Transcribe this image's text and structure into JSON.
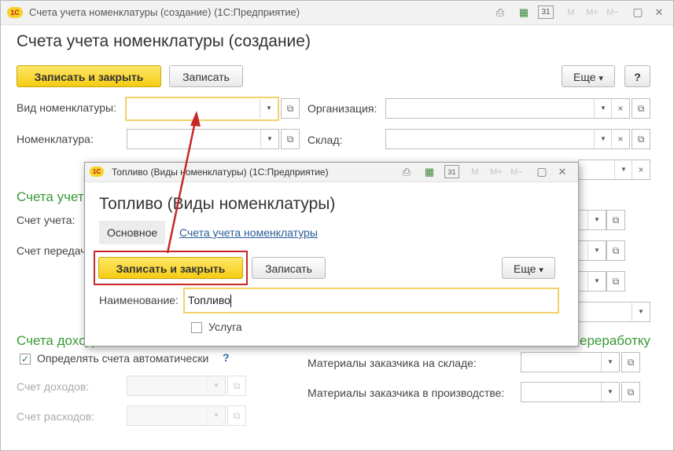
{
  "main": {
    "window_title": "Счета учета номенклатуры (создание)  (1С:Предприятие)",
    "heading": "Счета учета номенклатуры (создание)",
    "logo": "1С",
    "toolbar": {
      "save_close": "Записать и закрыть",
      "save": "Записать",
      "more": "Еще",
      "help": "?"
    },
    "fields": {
      "vid_label": "Вид номенклатуры:",
      "vid_value": "",
      "nom_label": "Номенклатура:",
      "nom_value": "",
      "org_label": "Организация:",
      "org_value": "",
      "sklad_label": "Склад:",
      "sklad_value": ""
    },
    "section_accounts": "Счета учета",
    "schet_ucheta_label": "Счет учета:",
    "schet_peredachi_label": "Счет передачи",
    "section_income": "Счета доходов",
    "auto_checkbox_label": "Определять счета автоматически",
    "help_mark": "?",
    "income_label": "Счет доходов:",
    "expense_label": "Счет расходов:",
    "section_processing": "ереработку",
    "mat_sklad_label": "Материалы заказчика на складе:",
    "mat_proizv_label": "Материалы заказчика в производстве:"
  },
  "popup": {
    "window_title": "Топливо (Виды номенклатуры)  (1С:Предприятие)",
    "heading": "Топливо (Виды номенклатуры)",
    "tab_main": "Основное",
    "tab_link": "Счета учета номенклатуры",
    "save_close": "Записать и закрыть",
    "save": "Записать",
    "more": "Еще",
    "name_label": "Наименование:",
    "name_value": "Топливо",
    "service_label": "Услуга"
  },
  "icons": {
    "print": "⎙",
    "calc": "▦",
    "calendar": "31",
    "m": "M",
    "mplus": "M+",
    "mminus": "M−",
    "restore": "▢",
    "close": "✕",
    "dropdown": "▼",
    "clear": "×",
    "open": "⧉",
    "more_arrow": "▾",
    "check": "✓"
  },
  "colors": {
    "accent_green": "#3a9a38",
    "primary_yellow": "#f5cc12",
    "highlight_red": "#c62828",
    "link_blue": "#2a5c9a"
  }
}
